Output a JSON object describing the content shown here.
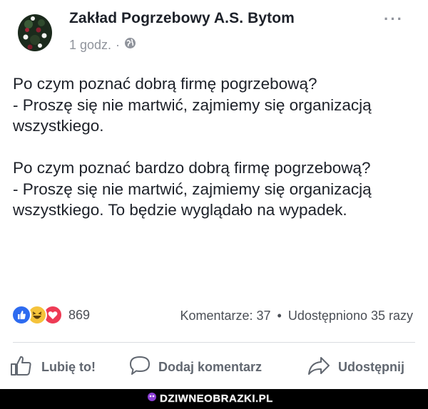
{
  "post": {
    "page_name": "Zakład Pogrzebowy A.S. Bytom",
    "time": "1 godz.",
    "separator": "·",
    "privacy_icon": "globe-icon",
    "more_label": "···",
    "paragraphs": [
      "Po czym poznać dobrą firmę pogrzebową?\n- Proszę się nie martwić, zajmiemy się organizacją wszystkiego.",
      "Po czym poznać bardzo dobrą firmę pogrzebową?\n- Proszę się nie martwić, zajmiemy się organizacją wszystkiego. To będzie wyglądało na wypadek."
    ]
  },
  "engagement": {
    "reaction_icons": [
      "like-icon",
      "haha-icon",
      "love-icon"
    ],
    "reaction_count": "869",
    "comments": "Komentarze: 37",
    "dot": "•",
    "shares": "Udostępniono 35 razy"
  },
  "actions": {
    "like": "Lubię to!",
    "comment": "Dodaj komentarz",
    "share": "Udostępnij"
  },
  "watermark": {
    "text": "DZIWNEOBRAZKI.PL"
  },
  "colors": {
    "like_blue": "#2e6bf0",
    "haha_yellow": "#f5c33b",
    "love_red": "#ee3b55",
    "secondary_text": "#90949c",
    "action_text": "#616770"
  }
}
